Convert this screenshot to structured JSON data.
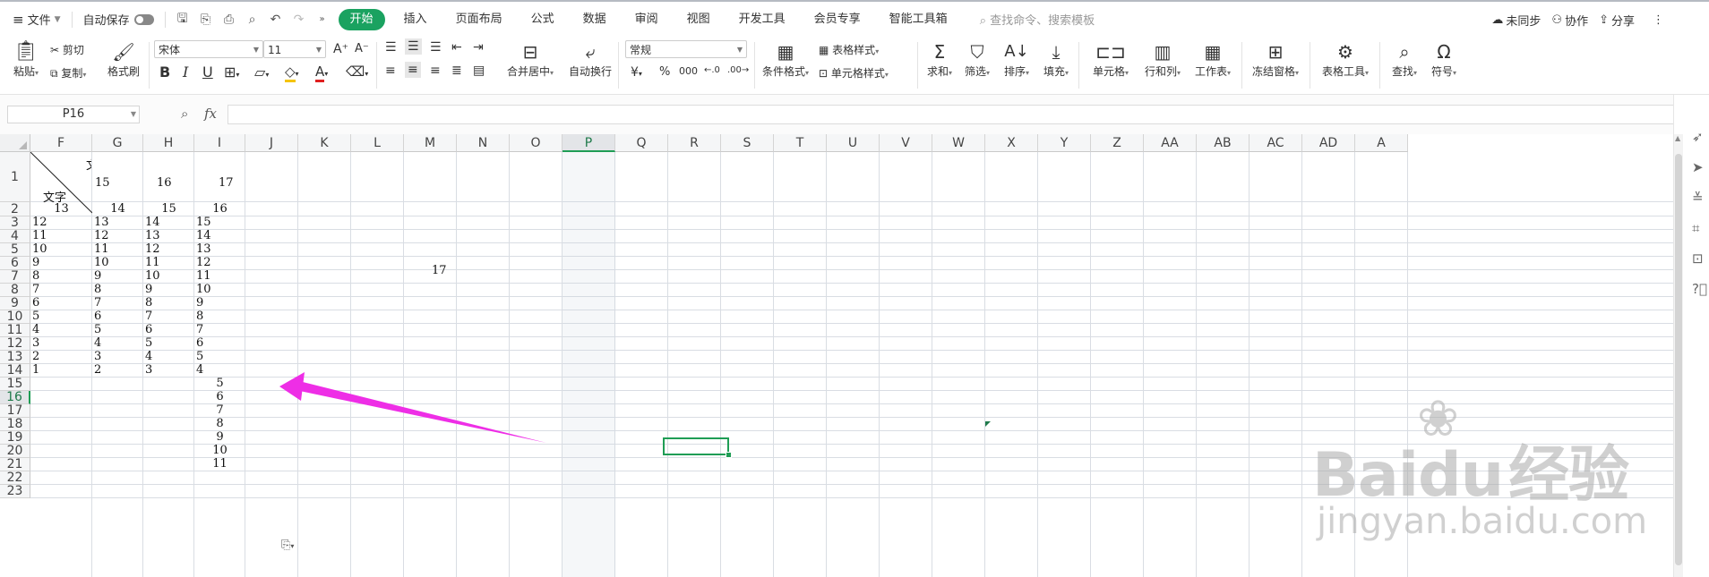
{
  "menubar": {
    "file_label": "文件",
    "autosave_label": "自动保存",
    "tabs": [
      "开始",
      "插入",
      "页面布局",
      "公式",
      "数据",
      "审阅",
      "视图",
      "开发工具",
      "会员专享",
      "智能工具箱"
    ],
    "search_placeholder": "查找命令、搜索模板",
    "unsynced": "未同步",
    "collab": "协作",
    "share": "分享"
  },
  "ribbon": {
    "paste": "粘贴",
    "cut": "剪切",
    "copy": "复制",
    "format_painter": "格式刷",
    "font_name": "宋体",
    "font_size": "11",
    "merge_center": "合并居中",
    "wrap_text": "自动换行",
    "number_format": "常规",
    "conditional_format": "条件格式",
    "table_style": "表格样式",
    "cell_style": "单元格样式",
    "sum": "求和",
    "filter": "筛选",
    "sort": "排序",
    "fill": "填充",
    "cell": "单元格",
    "row_col": "行和列",
    "worksheet": "工作表",
    "freeze": "冻结窗格",
    "table_tools": "表格工具",
    "find": "查找",
    "symbol": "符号"
  },
  "formula_bar": {
    "name_box": "P16",
    "fx_label": "fx",
    "formula": ""
  },
  "sheet": {
    "columns": [
      "F",
      "G",
      "H",
      "I",
      "J",
      "K",
      "L",
      "M",
      "N",
      "O",
      "P",
      "Q",
      "R",
      "S",
      "T",
      "U",
      "V",
      "W",
      "X",
      "Y",
      "Z",
      "AA",
      "AB",
      "AC",
      "AD",
      "A"
    ],
    "rows": [
      "1",
      "2",
      "3",
      "4",
      "5",
      "6",
      "7",
      "8",
      "9",
      "10",
      "11",
      "12",
      "13",
      "14",
      "15",
      "16",
      "17",
      "18",
      "19",
      "20",
      "21",
      "22",
      "23"
    ],
    "row1": {
      "diag_top": "文",
      "diag_bottom": "文字",
      "G": "15",
      "H": "16",
      "I": "17"
    },
    "row2": [
      "13",
      "14",
      "15",
      "16"
    ],
    "rows3to14": [
      [
        "12",
        "13",
        "14",
        "15"
      ],
      [
        "11",
        "12",
        "13",
        "14"
      ],
      [
        "10",
        "11",
        "12",
        "13"
      ],
      [
        "9",
        "10",
        "11",
        "12"
      ],
      [
        "8",
        "9",
        "10",
        "11"
      ],
      [
        "7",
        "8",
        "9",
        "10"
      ],
      [
        "6",
        "7",
        "8",
        "9"
      ],
      [
        "5",
        "6",
        "7",
        "8"
      ],
      [
        "4",
        "5",
        "6",
        "7"
      ],
      [
        "3",
        "4",
        "5",
        "6"
      ],
      [
        "2",
        "3",
        "4",
        "5"
      ],
      [
        "1",
        "2",
        "3",
        "4"
      ]
    ],
    "l5_value": "17",
    "i_extra": [
      "5",
      "6",
      "7",
      "8",
      "9",
      "10",
      "11"
    ],
    "selected_cell": "P16"
  },
  "watermark": {
    "brand": "Baidu",
    "brand_cn": "经验",
    "url": "jingyan.baidu.com"
  },
  "colors": {
    "accent": "#1aa260",
    "arrow": "#ee2ee6",
    "selection": "#1f9d55"
  }
}
